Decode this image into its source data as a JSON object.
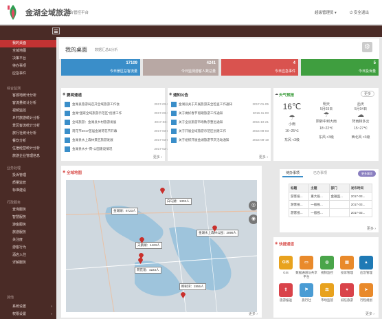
{
  "header": {
    "title": "金湖全域旅游",
    "subtitle": "综合管控平台",
    "user": "超级管理员",
    "logout": "安全退出"
  },
  "sidebar": {
    "items": [
      {
        "label": "我的桌面",
        "active": true
      },
      {
        "label": "全域地图"
      },
      {
        "label": "决策平台"
      },
      {
        "label": "待办事项"
      },
      {
        "label": "应急事件"
      }
    ],
    "group1": "综合监测",
    "group1_items": [
      "客源地统计分析",
      "客流量统计分析",
      "视频监控",
      "乡村旅游统计分析",
      "景区客流统计分析",
      "旅行社统计分析",
      "餐饮分析",
      "住宿经营统计分析",
      "旅游企业管理信息"
    ],
    "group2": "业务处理",
    "group2_items": [
      "投诉管理",
      "质量监管",
      "标准建设"
    ],
    "group3": "行政服务",
    "group3_items": [
      "查询服务",
      "智慧服务",
      "游客服务",
      "旅游服务",
      "关注度",
      "游客行为",
      "酒店入住",
      "详解服务"
    ],
    "group4": "其他",
    "group4_items": [
      "系统设置",
      "权限设置"
    ]
  },
  "page": {
    "title": "我的桌面",
    "subtitle": "数据汇总&分析"
  },
  "stats": [
    {
      "value": "17109",
      "label": "今日景区总客流量",
      "color": "#3a8ec9"
    },
    {
      "value": "4241",
      "label": "今日监测游客人数总量",
      "color": "#b8a8a4"
    },
    {
      "value": "4",
      "label": "今日应急事件",
      "color": "#d9534f"
    },
    {
      "value": "5",
      "label": "今日投诉量",
      "color": "#3f9e3f"
    }
  ],
  "news": {
    "title": "要闻速递",
    "items": [
      {
        "text": "金湖县旅游局召开全域旅游工作会",
        "date": "2017-03-24"
      },
      {
        "text": "金湖\"国家全域旅游示范区\"创建工作",
        "date": "2017-03-15"
      },
      {
        "text": "全域旅游：金湖县乡村旅游发展",
        "date": "2017-03-11"
      },
      {
        "text": "荷花节2017首届金湖荷花节开幕",
        "date": "2017-03-08"
      },
      {
        "text": "金湖县水上森林景区旅游发展",
        "date": "2017-03-02"
      },
      {
        "text": "金湖县水乡\"荷\"公园建设情况",
        "date": "2017-03-14"
      }
    ],
    "more": "更多"
  },
  "notices": {
    "title": "通知公告",
    "items": [
      {
        "text": "金湖县关于开展旅游安全检查工作通知",
        "date": "2017-01-05"
      },
      {
        "text": "关于做好春节假期旅游工作通知",
        "date": "2016-11-03"
      },
      {
        "text": "关于全县旅游市场秩序整治通知",
        "date": "2015-10-21"
      },
      {
        "text": "关于开展全域旅游示范区创建工作",
        "date": "2015-09-03"
      },
      {
        "text": "关于组织开展金湖旅游节庆活动通知",
        "date": "2015-09-19"
      }
    ],
    "more": "更多"
  },
  "weather": {
    "title": "天气预报",
    "more": "更多",
    "today": {
      "temp": "16℃",
      "desc": "小雨",
      "range": "16~25℃",
      "wind": "东风 <3级"
    },
    "d2": {
      "day": "明天",
      "date": "5月03日",
      "desc": "阴转中到大雨",
      "range": "18~22℃",
      "wind": "东风 <3级"
    },
    "d3": {
      "day": "后天",
      "date": "5月04日",
      "desc": "阵雨转多云",
      "range": "15~27℃",
      "wind": "西北风 <3级"
    }
  },
  "map": {
    "title": "全域地图",
    "labels": [
      {
        "text": "白马湖：1303人"
      },
      {
        "text": "金湖湖：8723人"
      },
      {
        "text": "金湖水上森林公园：2899人"
      },
      {
        "text": "天鹅湖：1423人"
      },
      {
        "text": "荷花荡：4223人"
      },
      {
        "text": "柳树湾：2856人"
      }
    ],
    "more": "更多"
  },
  "todo": {
    "tab1": "待办事项",
    "tab2": "已办事项",
    "badge": "更多事项",
    "headers": [
      "标题",
      "主题",
      "部门",
      "发布时间"
    ],
    "rows": [
      [
        "游客投...",
        "重大投...",
        "金融监...",
        "2017-03..."
      ],
      [
        "游客投...",
        "一般投...",
        "",
        "2017-03..."
      ],
      [
        "游客投...",
        "一般投...",
        "",
        "2017-03..."
      ]
    ],
    "more": "更多"
  },
  "apps": {
    "title": "快捷通道",
    "items": [
      {
        "label": "GIS",
        "icon": "gis-icon",
        "color": "#e8a21e"
      },
      {
        "label": "数据通道与共享平台",
        "icon": "monitor-icon",
        "color": "#e98a2b"
      },
      {
        "label": "视频监控",
        "icon": "camera-icon",
        "color": "#4aa54a"
      },
      {
        "label": "投诉管理",
        "icon": "document-icon",
        "color": "#e98a2b"
      },
      {
        "label": "应急管理",
        "icon": "alert-icon",
        "color": "#1f7ab5"
      },
      {
        "label": "旅游报送",
        "icon": "upload-icon",
        "color": "#d9434a"
      },
      {
        "label": "旅行社",
        "icon": "flag-icon",
        "color": "#4a9cd4"
      },
      {
        "label": "市场监管",
        "icon": "scale-icon",
        "color": "#e8a21e"
      },
      {
        "label": "诚信旅游",
        "icon": "handshake-icon",
        "color": "#d9434a"
      },
      {
        "label": "行程规划",
        "icon": "route-icon",
        "color": "#e98a2b"
      }
    ],
    "more": "更多"
  }
}
